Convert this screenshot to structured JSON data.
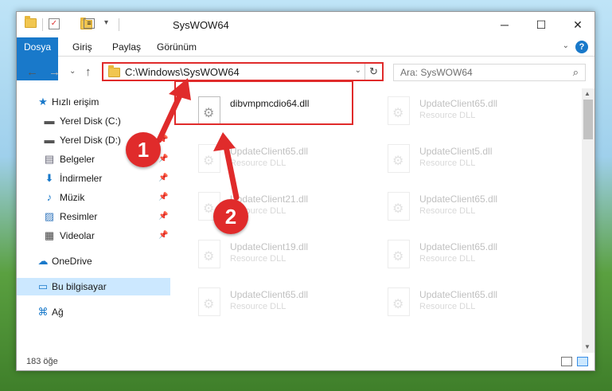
{
  "window": {
    "title": "SysWOW64",
    "minimize": "─",
    "maximize": "☐",
    "close": "✕"
  },
  "ribbon": {
    "tabs": [
      "Dosya",
      "Giriş",
      "Paylaş",
      "Görünüm"
    ],
    "help": "?"
  },
  "address": {
    "path": "C:\\Windows\\SysWOW64",
    "refresh": "↻",
    "dropdown": "⌄"
  },
  "search": {
    "placeholder": "Ara: SysWOW64"
  },
  "nav": {
    "back": "←",
    "forward": "→",
    "recent": "⌄",
    "up": "↑"
  },
  "sidebar": {
    "items": [
      {
        "label": "Hızlı erişim",
        "icon": "★"
      },
      {
        "label": "Yerel Disk (C:)",
        "icon": "▬"
      },
      {
        "label": "Yerel Disk (D:)",
        "icon": "▬"
      },
      {
        "label": "Belgeler",
        "icon": "▤"
      },
      {
        "label": "İndirmeler",
        "icon": "⬇"
      },
      {
        "label": "Müzik",
        "icon": "♪"
      },
      {
        "label": "Resimler",
        "icon": "▨"
      },
      {
        "label": "Videolar",
        "icon": "▦"
      },
      {
        "label": "OneDrive",
        "icon": "☁"
      },
      {
        "label": "Bu bilgisayar",
        "icon": "▭"
      },
      {
        "label": "Ağ",
        "icon": "⌘"
      }
    ],
    "pin": "📌"
  },
  "files": {
    "main": {
      "name": "dibvmpmcdio64.dll"
    },
    "items": [
      {
        "name": "UpdateClient65.dll",
        "type": "Resource DLL"
      },
      {
        "name": "UpdateClient65.dll",
        "type": "Resource DLL"
      },
      {
        "name": "UpdateClient5.dll",
        "type": "Resource DLL"
      },
      {
        "name": "UpdateClient21.dll",
        "type": "Resource DLL"
      },
      {
        "name": "UpdateClient65.dll",
        "type": "Resource DLL"
      },
      {
        "name": "UpdateClient19.dll",
        "type": "Resource DLL"
      },
      {
        "name": "UpdateClient65.dll",
        "type": "Resource DLL"
      },
      {
        "name": "UpdateClient65.dll",
        "type": "Resource DLL"
      },
      {
        "name": "UpdateClient65.dll",
        "type": "Resource DLL"
      }
    ]
  },
  "status": {
    "count": "183 öğe"
  },
  "callouts": {
    "one": "1",
    "two": "2"
  },
  "colors": {
    "accent": "#1979ca",
    "callout": "#e02b2b"
  }
}
